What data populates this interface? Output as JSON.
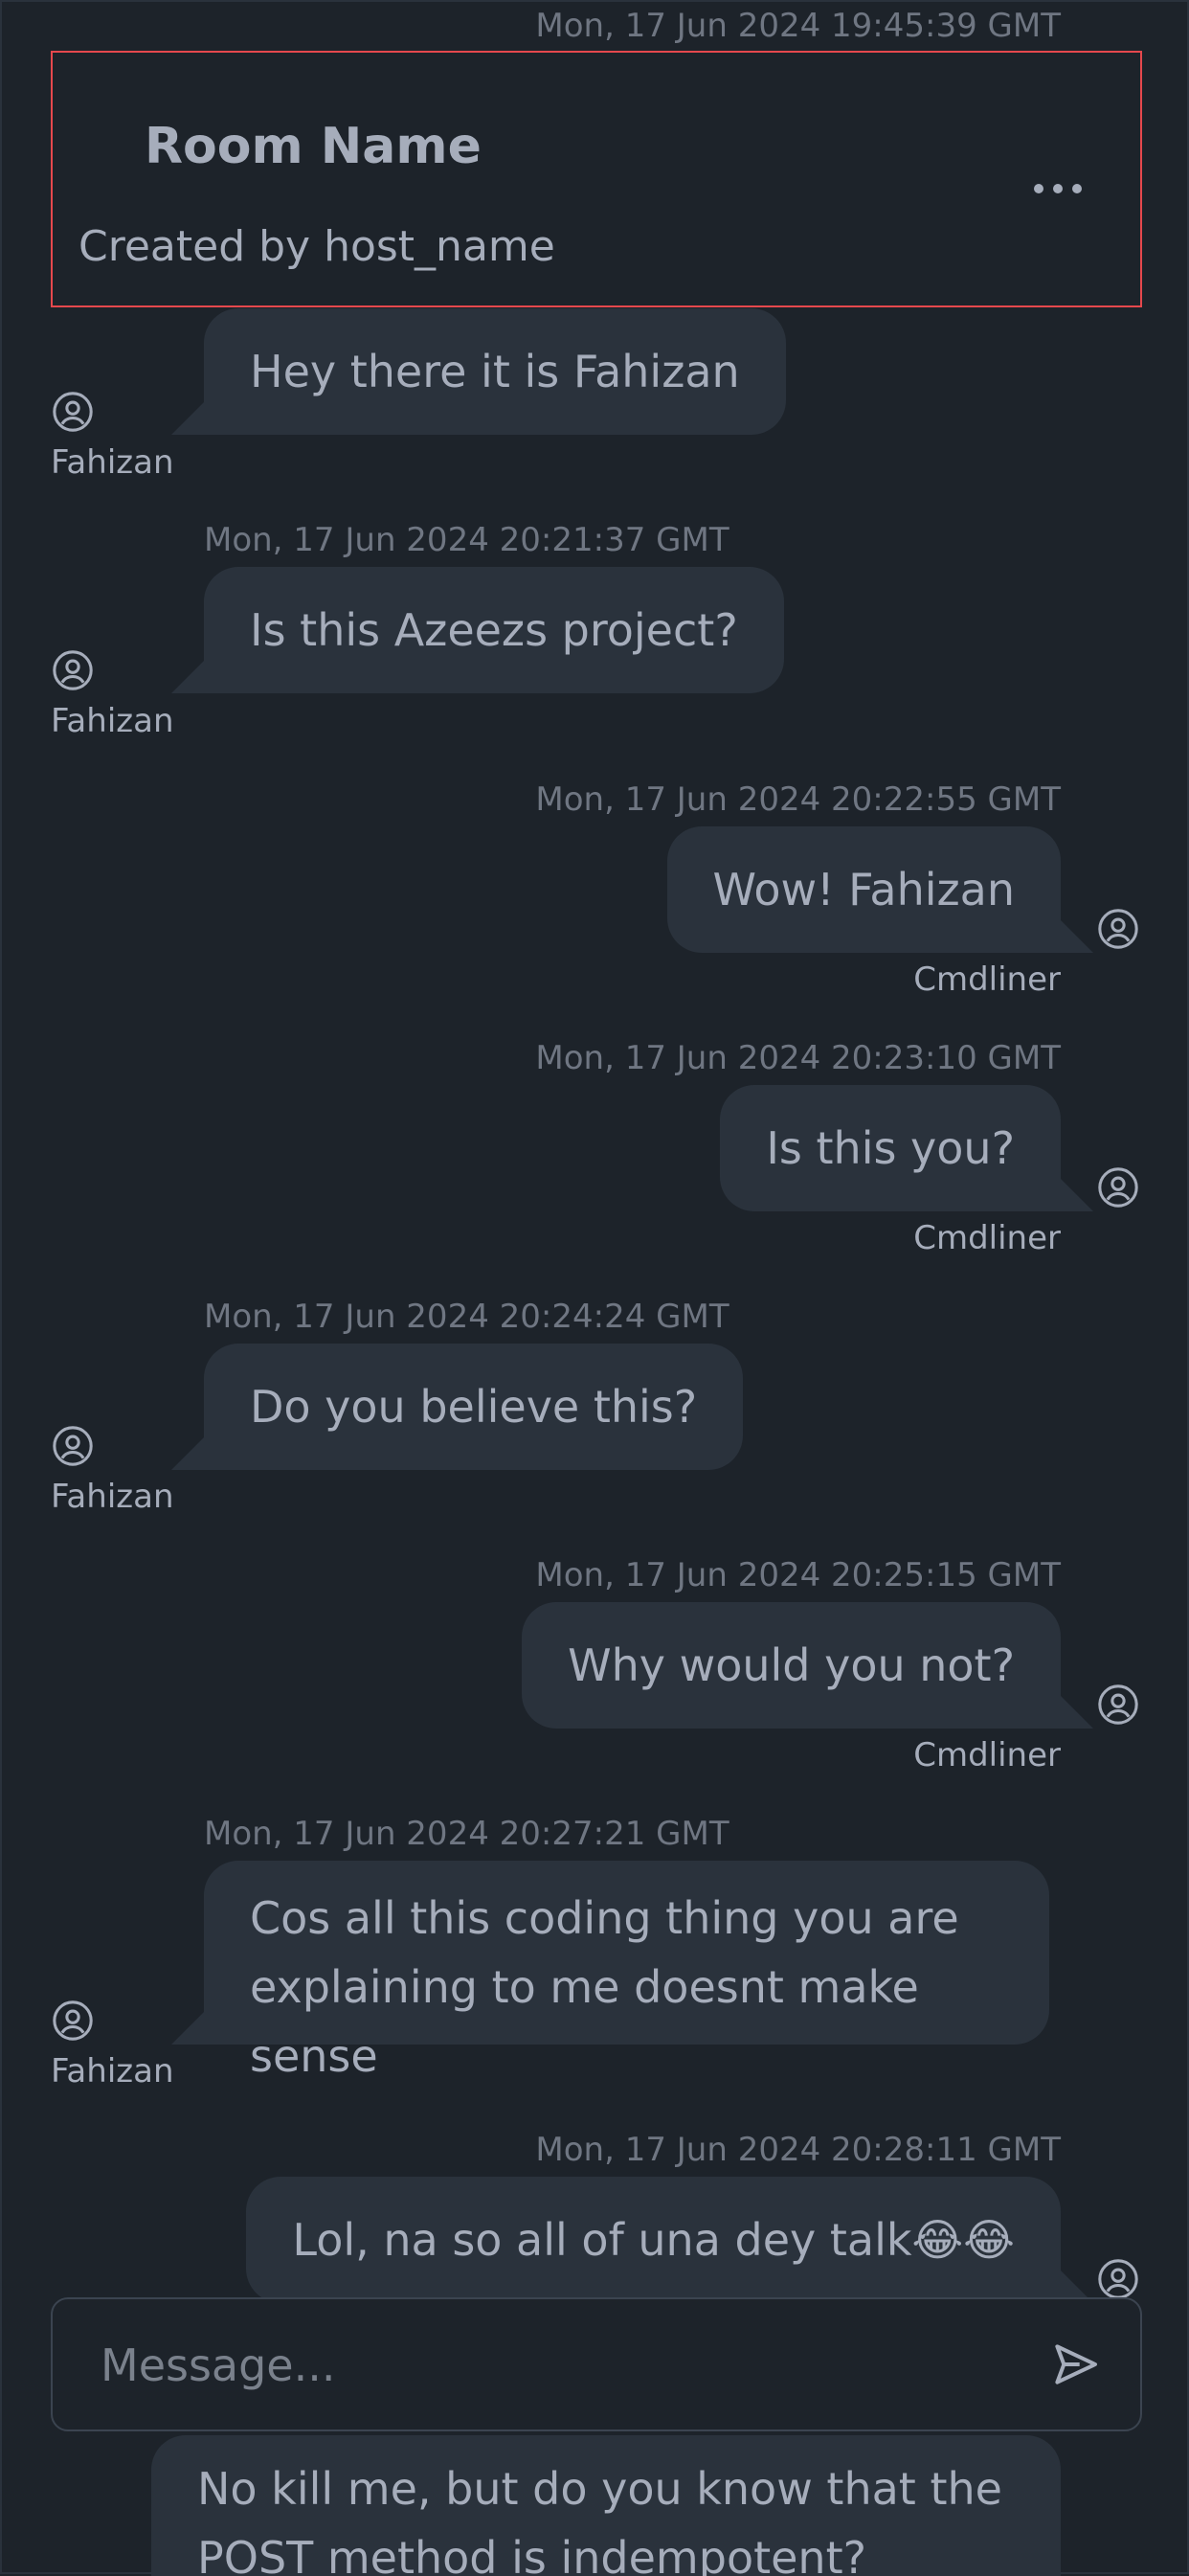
{
  "room": {
    "title": "Room Name",
    "subtitle": "Created by host_name",
    "top_timestamp": "Mon, 17 Jun 2024 19:45:39 GMT"
  },
  "messages": [
    {
      "side": "left",
      "text": "Hey there it is Fahizan",
      "sender": "Fahizan",
      "timestamp": ""
    },
    {
      "side": "left",
      "text": "Is this Azeezs project?",
      "sender": "Fahizan",
      "timestamp": "Mon, 17 Jun 2024 20:21:37 GMT"
    },
    {
      "side": "right",
      "text": "Wow! Fahizan",
      "sender": "Cmdliner",
      "timestamp": "Mon, 17 Jun 2024 20:22:55 GMT"
    },
    {
      "side": "right",
      "text": "Is this you?",
      "sender": "Cmdliner",
      "timestamp": "Mon, 17 Jun 2024 20:23:10 GMT"
    },
    {
      "side": "left",
      "text": "Do you believe this?",
      "sender": "Fahizan",
      "timestamp": "Mon, 17 Jun 2024 20:24:24 GMT"
    },
    {
      "side": "right",
      "text": "Why would you not?",
      "sender": "Cmdliner",
      "timestamp": "Mon, 17 Jun 2024 20:25:15 GMT"
    },
    {
      "side": "left",
      "text": "Cos all this coding thing you are explaining to me doesnt make sense",
      "sender": "Fahizan",
      "timestamp": "Mon, 17 Jun 2024 20:27:21 GMT"
    },
    {
      "side": "right",
      "text": "Lol, na so all of una dey talk😂😂",
      "sender": "",
      "timestamp": "Mon, 17 Jun 2024 20:28:11 GMT"
    },
    {
      "side": "right",
      "text": "No kill me, but do you know that the POST method is indempotent?",
      "sender": "",
      "timestamp": ""
    }
  ],
  "composer": {
    "placeholder": "Message..."
  },
  "icons": {
    "avatar": "user-circle-icon",
    "menu": "ellipsis-icon",
    "send": "send-icon"
  }
}
